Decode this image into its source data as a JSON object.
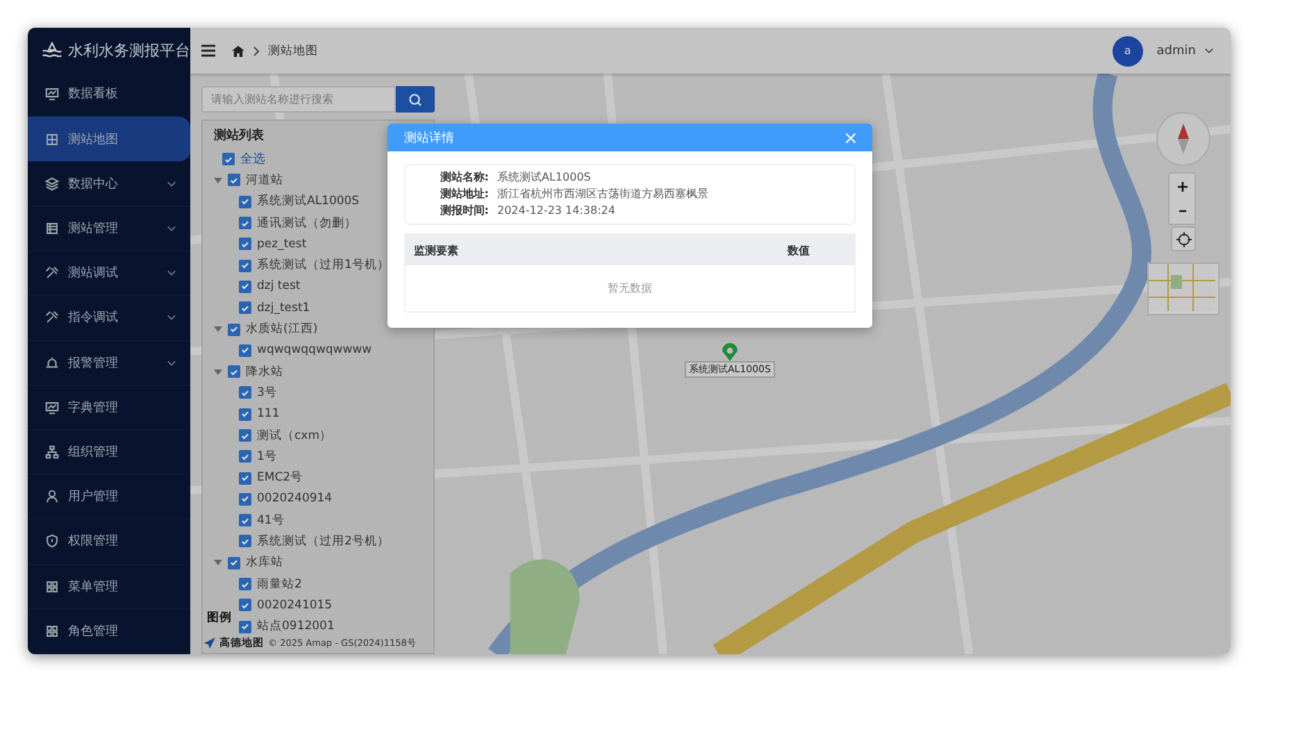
{
  "app": {
    "title": "水利水务测报平台"
  },
  "sidebar": {
    "items": [
      {
        "label": "数据看板",
        "selected": false,
        "has_submenu": false
      },
      {
        "label": "测站地图",
        "selected": true,
        "has_submenu": false
      },
      {
        "label": "数据中心",
        "selected": false,
        "has_submenu": true
      },
      {
        "label": "测站管理",
        "selected": false,
        "has_submenu": true
      },
      {
        "label": "测站调试",
        "selected": false,
        "has_submenu": true
      },
      {
        "label": "指令调试",
        "selected": false,
        "has_submenu": true
      },
      {
        "label": "报警管理",
        "selected": false,
        "has_submenu": true
      },
      {
        "label": "字典管理",
        "selected": false,
        "has_submenu": false
      },
      {
        "label": "组织管理",
        "selected": false,
        "has_submenu": false
      },
      {
        "label": "用户管理",
        "selected": false,
        "has_submenu": false
      },
      {
        "label": "权限管理",
        "selected": false,
        "has_submenu": false
      },
      {
        "label": "菜单管理",
        "selected": false,
        "has_submenu": false
      },
      {
        "label": "角色管理",
        "selected": false,
        "has_submenu": false
      }
    ]
  },
  "header": {
    "breadcrumb": "测站地图",
    "user": {
      "avatar": "a",
      "name": "admin"
    }
  },
  "station_panel": {
    "search": {
      "placeholder": "请输入测站名称进行搜索"
    },
    "title": "测站列表",
    "select_all": {
      "label": "全选",
      "checked": true
    },
    "tree": [
      {
        "label": "河道站",
        "checked": true,
        "expanded": true,
        "children": [
          {
            "label": "系统测试AL1000S",
            "checked": true
          },
          {
            "label": "通讯测试（勿删）",
            "checked": true
          },
          {
            "label": "pez_test",
            "checked": true
          },
          {
            "label": "系统测试（过用1号机）",
            "checked": true
          },
          {
            "label": "dzj test",
            "checked": true
          },
          {
            "label": "dzj_test1",
            "checked": true
          }
        ]
      },
      {
        "label": "水质站(江西)",
        "checked": true,
        "expanded": true,
        "children": [
          {
            "label": "wqwqwqqwqwwww",
            "checked": true
          }
        ]
      },
      {
        "label": "降水站",
        "checked": true,
        "expanded": true,
        "children": [
          {
            "label": "3号",
            "checked": true
          },
          {
            "label": "111",
            "checked": true
          },
          {
            "label": "测试（cxm）",
            "checked": true
          },
          {
            "label": "1号",
            "checked": true
          },
          {
            "label": "EMC2号",
            "checked": true
          },
          {
            "label": "0020240914",
            "checked": true
          },
          {
            "label": "41号",
            "checked": true
          },
          {
            "label": "系统测试（过用2号机）",
            "checked": true
          }
        ]
      },
      {
        "label": "水库站",
        "checked": true,
        "expanded": true,
        "children": [
          {
            "label": "雨量站2",
            "checked": true
          },
          {
            "label": "0020241015",
            "checked": true
          },
          {
            "label": "站点0912001",
            "checked": true
          }
        ]
      }
    ]
  },
  "map": {
    "marker": {
      "label": "系统测试AL1000S"
    },
    "legend": "图例",
    "logo": "高德地图",
    "attribution": "© 2025 Amap - GS(2024)1158号"
  },
  "dialog": {
    "title": "测站详情",
    "fields": [
      {
        "label": "测站名称:",
        "value": "系统测试AL1000S"
      },
      {
        "label": "测站地址:",
        "value": "浙江省杭州市西湖区古荡街道方易西塞枫景"
      },
      {
        "label": "测报时间:",
        "value": "2024-12-23 14:38:24"
      }
    ],
    "table": {
      "columns": [
        "监测要素",
        "数值"
      ],
      "empty_text": "暂无数据"
    }
  }
}
